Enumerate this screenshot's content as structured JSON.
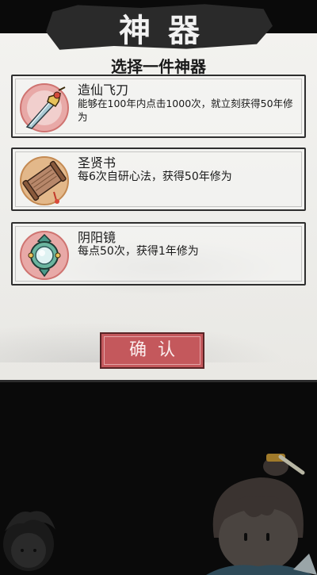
{
  "title": "神器",
  "subtitle": "选择一件神器",
  "items": [
    {
      "name": "造仙飞刀",
      "description": "能够在100年内点击1000次，就立刻获得50年修为",
      "icon": "flying-sword-icon"
    },
    {
      "name": "圣贤书",
      "description": "每6次自研心法，获得50年修为",
      "icon": "scroll-icon"
    },
    {
      "name": "阴阳镜",
      "description": "每点50次，获得1年修为",
      "icon": "jade-mirror-icon"
    }
  ],
  "confirm_label": "确认",
  "colors": {
    "accent": "#c4585c",
    "panel": "#efeeeb",
    "banner": "#2a2a2a",
    "background": "#0a0a0a"
  }
}
